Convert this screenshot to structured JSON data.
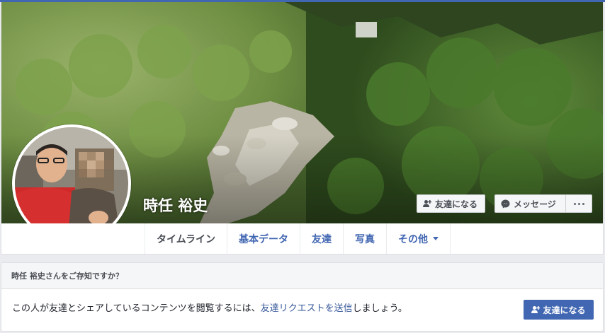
{
  "profile": {
    "name": "時任 裕史"
  },
  "actions": {
    "add_friend_label": "友達になる",
    "message_label": "メッセージ"
  },
  "tabs": [
    {
      "label": "タイムライン",
      "active": true
    },
    {
      "label": "基本データ",
      "active": false
    },
    {
      "label": "友達",
      "active": false
    },
    {
      "label": "写真",
      "active": false
    },
    {
      "label": "その他",
      "active": false,
      "has_dropdown": true
    }
  ],
  "know_card": {
    "heading": "時任 裕史さんをご存知ですか？",
    "body_before": "この人が友達とシェアしているコンテンツを閲覧するには、",
    "body_link": "友達リクエストを送信",
    "body_after": "しましょう。",
    "button_label": "友達になる"
  },
  "icons": {
    "add_friend": "person-plus-icon",
    "messenger": "messenger-icon",
    "more": "more-dots-icon",
    "dropdown": "caret-down-icon"
  },
  "colors": {
    "brand": "#4267b2",
    "link": "#365899",
    "page_bg": "#e9ebee"
  }
}
